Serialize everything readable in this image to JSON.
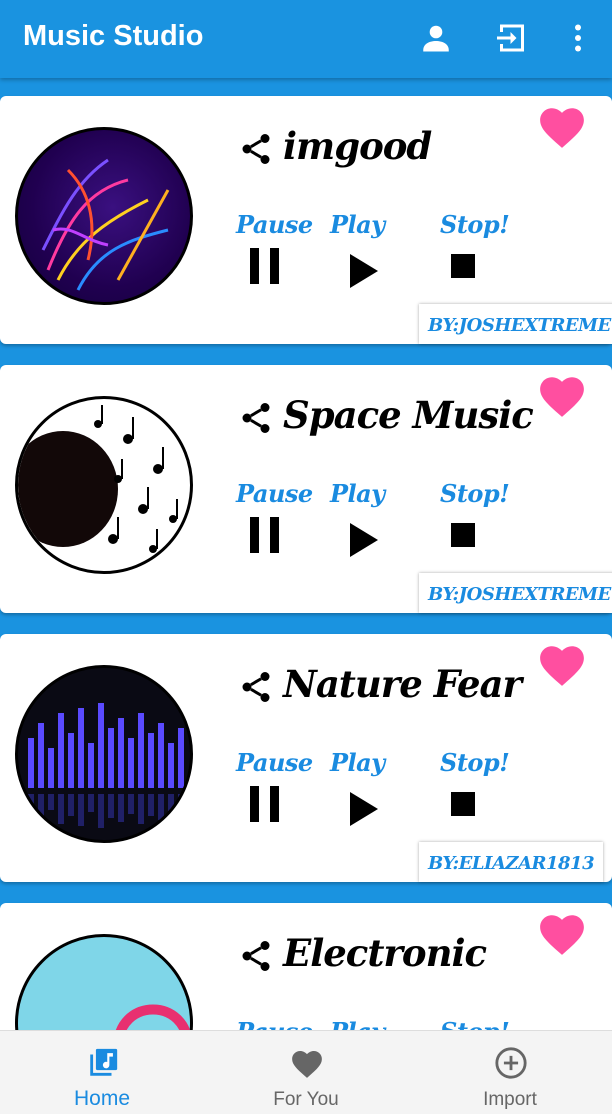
{
  "app": {
    "title": "Music Studio"
  },
  "appbar_actions": [
    "account-icon",
    "exit-icon",
    "more-vert-icon"
  ],
  "labels": {
    "pause": "Pause",
    "play": "Play",
    "stop": "Stop!"
  },
  "cards": [
    {
      "title": "imgood",
      "author": "BY:JOSHEXTREME"
    },
    {
      "title": "Space Music",
      "author": "BY:JOSHEXTREME"
    },
    {
      "title": "Nature Fear",
      "author": "BY:ELIAZAR1813"
    },
    {
      "title": "Electronic",
      "author": ""
    }
  ],
  "nav": [
    {
      "label": "Home",
      "icon": "music-library-icon",
      "active": true
    },
    {
      "label": "For You",
      "icon": "heart-icon",
      "active": false
    },
    {
      "label": "Import",
      "icon": "add-circle-icon",
      "active": false
    }
  ],
  "colors": {
    "primary": "#1a93e0",
    "accent_text": "#1a8be0",
    "heart": "#ff4fa0"
  }
}
